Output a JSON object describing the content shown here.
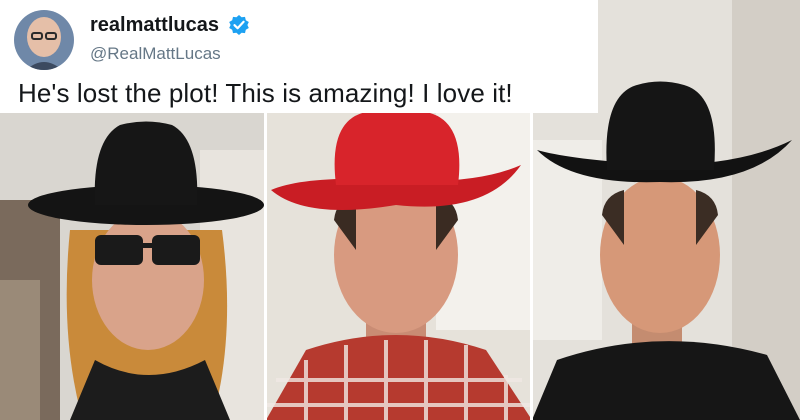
{
  "tweet": {
    "display_name": "realmattlucas",
    "handle": "@RealMattLucas",
    "verified": true,
    "text": "He's lost the plot! This is amazing! I love it!"
  },
  "video_stills": [
    {
      "description_icon": "person-black-cowboy-hat-sunglasses",
      "hat_color": "#111111"
    },
    {
      "description_icon": "person-red-cowboy-hat-plaid-shirt",
      "hat_color": "#d42127"
    },
    {
      "description_icon": "person-black-cowboy-hat-black-shirt",
      "hat_color": "#111111"
    }
  ],
  "colors": {
    "verified_blue": "#1da1f2",
    "text_primary": "#14171a",
    "text_secondary": "#657786"
  }
}
